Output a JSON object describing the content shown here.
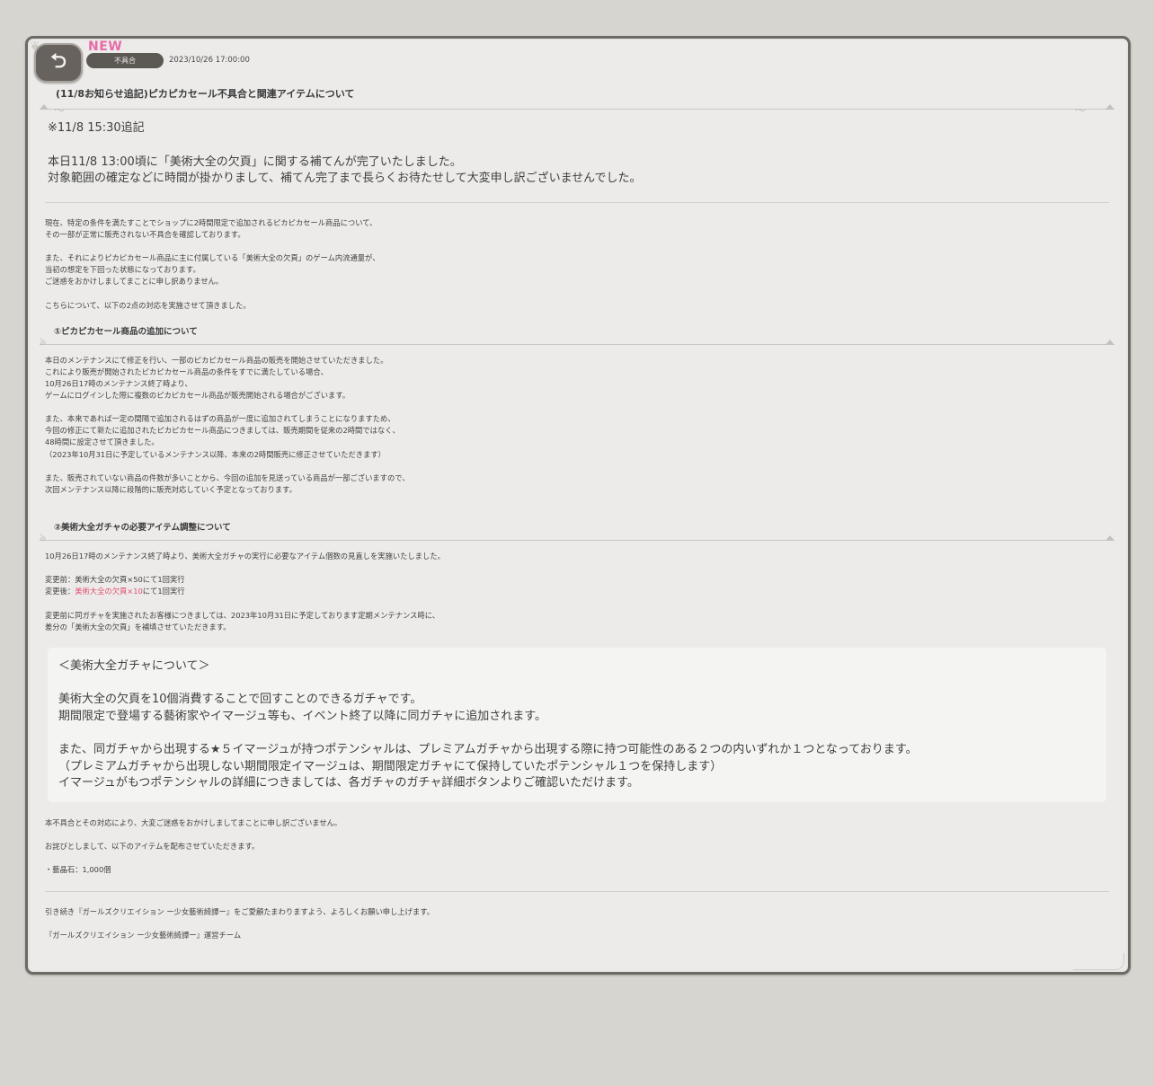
{
  "header": {
    "new_badge": "NEW",
    "category": "不具合",
    "date": "2023/10/26 17:00:00",
    "title": "(11/8お知らせ追記)ピカピカセール不具合と関連アイテムについて"
  },
  "update": {
    "label": "※11/8 15:30追記",
    "line1": "本日11/8 13:00頃に「美術大全の欠頁」に関する補てんが完了いたしました。",
    "line2": "対象範囲の確定などに時間が掛かりまして、補てん完了まで長らくお待たせして大変申し訳ございませんでした。"
  },
  "intro": {
    "p1_l1": "現在、特定の条件を満たすことでショップに2時間限定で追加されるピカピカセール商品について、",
    "p1_l2": "その一部が正常に販売されない不具合を確認しております。",
    "p2_l1": "また、それによりピカピカセール商品に主に付属している「美術大全の欠頁」のゲーム内流通量が、",
    "p2_l2": "当初の想定を下回った状態になっております。",
    "p2_l3": "ご迷惑をおかけしましてまことに申し訳ありません。",
    "p3": "こちらについて、以下の2点の対応を実施させて頂きました。"
  },
  "section1": {
    "heading": "①ピカピカセール商品の追加について",
    "l1": "本日のメンテナンスにて修正を行い、一部のピカピカセール商品の販売を開始させていただきました。",
    "l2": "これにより販売が開始されたピカピカセール商品の条件をすでに満たしている場合、",
    "l3": "10月26日17時のメンテナンス終了時より、",
    "l4": "ゲームにログインした際に複数のピカピカセール商品が販売開始される場合がございます。",
    "l5": "また、本来であれば一定の間隔で追加されるはずの商品が一度に追加されてしまうことになりますため、",
    "l6": "今回の修正にて新たに追加されたピカピカセール商品につきましては、販売期間を従来の2時間ではなく、",
    "l7": "48時間に設定させて頂きました。",
    "l8": "（2023年10月31日に予定しているメンテナンス以降、本来の2時間販売に修正させていただきます）",
    "l9": "また、販売されていない商品の件数が多いことから、今回の追加を見送っている商品が一部ございますので、",
    "l10": "次回メンテナンス以降に段階的に販売対応していく予定となっております。"
  },
  "section2": {
    "heading": "②美術大全ガチャの必要アイテム調整について",
    "l1": "10月26日17時のメンテナンス終了時より、美術大全ガチャの実行に必要なアイテム個数の見直しを実施いたしました。",
    "before": "変更前：美術大全の欠頁×50にて1回実行",
    "after_prefix": "変更後：",
    "after_highlight": "美術大全の欠頁×10",
    "after_suffix": "にて1回実行",
    "l2": "変更前に同ガチャを実施されたお客様につきましては、2023年10月31日に予定しております定期メンテナンス時に、",
    "l3": "差分の「美術大全の欠頁」を補填させていただきます。"
  },
  "infobox": {
    "heading": "＜美術大全ガチャについて＞",
    "l1": "美術大全の欠頁を10個消費することで回すことのできるガチャです。",
    "l2": "期間限定で登場する藝術家やイマージュ等も、イベント終了以降に同ガチャに追加されます。",
    "l3": "また、同ガチャから出現する★５イマージュが持つポテンシャルは、プレミアムガチャから出現する際に持つ可能性のある２つの内いずれか１つとなっております。",
    "l4": "（プレミアムガチャから出現しない期間限定イマージュは、期間限定ガチャにて保持していたポテンシャル１つを保持します）",
    "l5": "イマージュがもつポテンシャルの詳細につきましては、各ガチャのガチャ詳細ボタンよりご確認いただけます。"
  },
  "closing": {
    "l1": "本不具合とその対応により、大変ご迷惑をおかけしましてまことに申し訳ございません。",
    "l2": "お詫びとしまして、以下のアイテムを配布させていただきます。",
    "l3": "・藝晶石：1,000個",
    "l4": "引き続き『ガールズクリエイション ー少女藝術綺譚ー』をご愛顧たまわりますよう、よろしくお願い申し上げます。",
    "l5": "『ガールズクリエイション ー少女藝術綺譚ー』運営チーム"
  },
  "colors": {
    "highlight": "#e24a6d",
    "new_badge": "#e86aa8",
    "background": "#d6d5d0",
    "panel": "#ecebea"
  },
  "icons": {
    "back": "back-arrow-icon"
  }
}
